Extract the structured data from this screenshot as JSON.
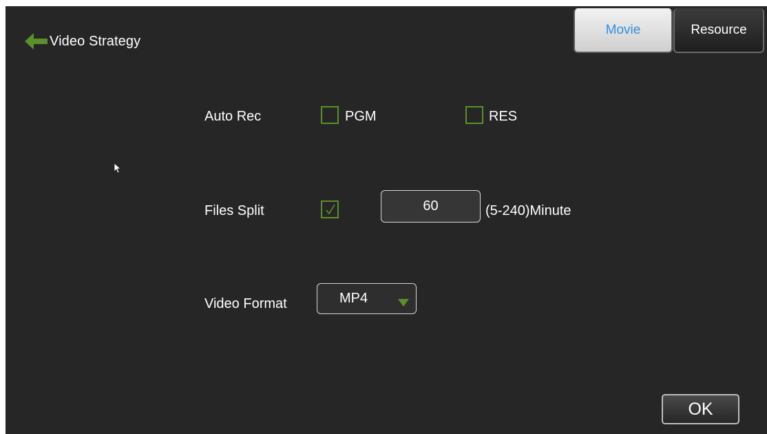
{
  "header": {
    "title": "Video Strategy",
    "back_icon": "arrow-left-icon"
  },
  "tabs": [
    {
      "label": "Movie",
      "active": true
    },
    {
      "label": "Resource",
      "active": false
    }
  ],
  "auto_rec": {
    "label": "Auto Rec",
    "options": [
      {
        "label": "PGM",
        "checked": false
      },
      {
        "label": "RES",
        "checked": false
      }
    ]
  },
  "files_split": {
    "label": "Files Split",
    "checked": true,
    "value": "60",
    "range_text": "(5-240)Minute"
  },
  "video_format": {
    "label": "Video Format",
    "selected": "MP4"
  },
  "footer": {
    "ok_label": "OK"
  },
  "colors": {
    "background": "#262626",
    "accent_green": "#5b8f2a",
    "active_tab_text": "#2e8fe0"
  }
}
